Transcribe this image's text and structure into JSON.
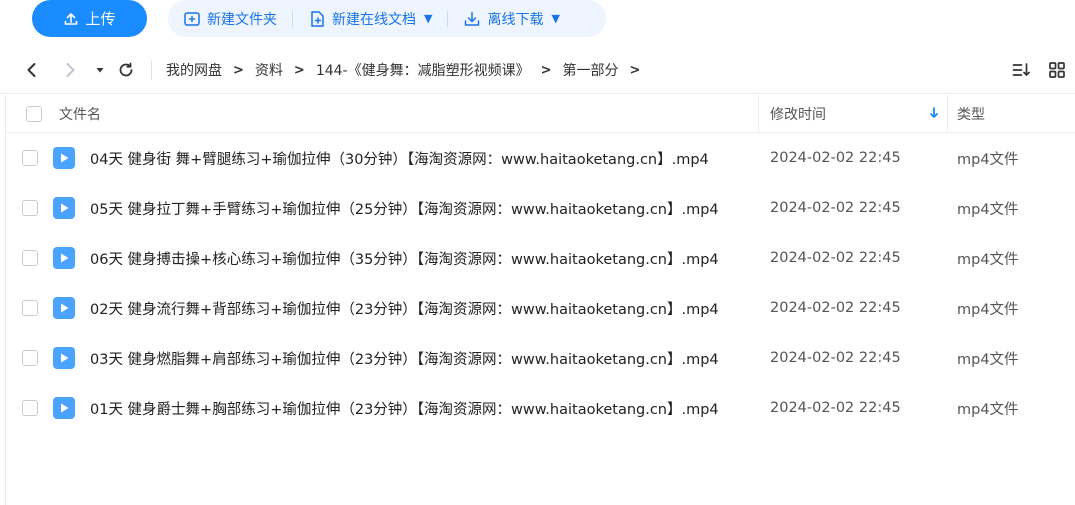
{
  "toolbar": {
    "upload_label": "上传",
    "new_folder_label": "新建文件夹",
    "new_doc_label": "新建在线文档",
    "offline_download_label": "离线下载"
  },
  "breadcrumb": [
    "我的网盘",
    "资料",
    "144-《健身舞：减脂塑形视频课》",
    "第一部分"
  ],
  "table": {
    "columns": {
      "name": "文件名",
      "time": "修改时间",
      "type": "类型"
    },
    "rows": [
      {
        "name": "04天 健身街  舞+臂腿练习+瑜伽拉伸（30分钟）【海淘资源网：www.haitaoketang.cn】.mp4",
        "time": "2024-02-02 22:45",
        "type": "mp4文件"
      },
      {
        "name": "05天 健身拉丁舞+手臂练习+瑜伽拉伸（25分钟）【海淘资源网：www.haitaoketang.cn】.mp4",
        "time": "2024-02-02 22:45",
        "type": "mp4文件"
      },
      {
        "name": "06天 健身搏击操+核心练习+瑜伽拉伸（35分钟）【海淘资源网：www.haitaoketang.cn】.mp4",
        "time": "2024-02-02 22:45",
        "type": "mp4文件"
      },
      {
        "name": "02天 健身流行舞+背部练习+瑜伽拉伸（23分钟）【海淘资源网：www.haitaoketang.cn】.mp4",
        "time": "2024-02-02 22:45",
        "type": "mp4文件"
      },
      {
        "name": "03天 健身燃脂舞+肩部练习+瑜伽拉伸（23分钟）【海淘资源网：www.haitaoketang.cn】.mp4",
        "time": "2024-02-02 22:45",
        "type": "mp4文件"
      },
      {
        "name": "01天 健身爵士舞+胸部练习+瑜伽拉伸（23分钟）【海淘资源网：www.haitaoketang.cn】.mp4",
        "time": "2024-02-02 22:45",
        "type": "mp4文件"
      }
    ]
  },
  "colors": {
    "accent": "#1a8cff",
    "link": "#1a73e8",
    "file_icon": "#4aa3ff"
  }
}
